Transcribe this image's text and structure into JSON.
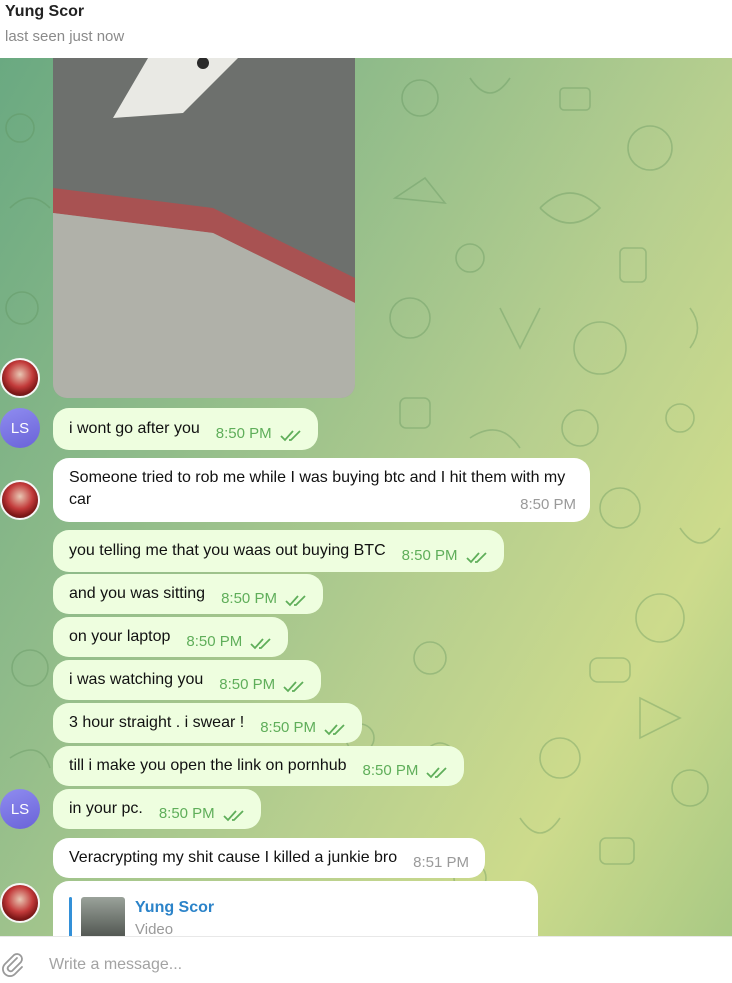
{
  "header": {
    "name": "Yung Scor",
    "status": "last seen just now"
  },
  "avatars": {
    "ls_initials": "LS"
  },
  "messages": [
    {
      "text": "i wont go after you",
      "time": "8:50 PM"
    },
    {
      "text": "Someone tried to rob me while I was buying btc and I hit them with my car",
      "time": "8:50 PM"
    },
    {
      "text": "you telling me that you waas out buying BTC",
      "time": "8:50 PM"
    },
    {
      "text": "and you was sitting",
      "time": "8:50 PM"
    },
    {
      "text": "on your laptop",
      "time": "8:50 PM"
    },
    {
      "text": "i was watching you",
      "time": "8:50 PM"
    },
    {
      "text": "3 hour straight . i swear !",
      "time": "8:50 PM"
    },
    {
      "text": "till i make you open the link on pornhub",
      "time": "8:50 PM"
    },
    {
      "text": "in your pc.",
      "time": "8:50 PM"
    },
    {
      "text": "Veracrypting my shit cause I killed a junkie bro",
      "time": "8:51 PM"
    }
  ],
  "video_card": {
    "name": "Yung Scor",
    "type": "Video"
  },
  "composer": {
    "placeholder": "Write a message..."
  },
  "colors": {
    "outgoing_bubble": "#eefedf",
    "incoming_bubble": "#ffffff",
    "accent": "#5fae5a",
    "link": "#2b83c9"
  },
  "icons": {
    "attach": "paperclip-icon",
    "read_receipt": "double-check-icon"
  }
}
